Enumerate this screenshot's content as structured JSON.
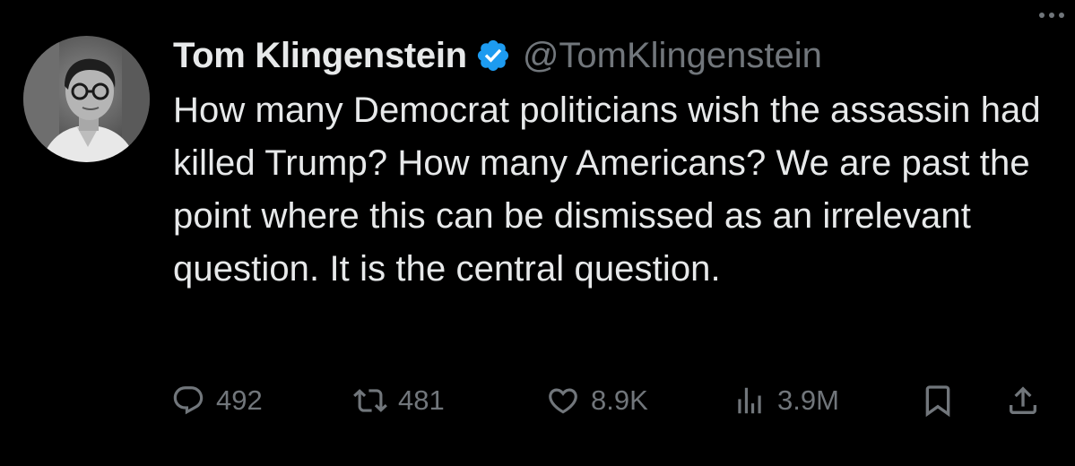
{
  "tweet": {
    "display_name": "Tom Klingenstein",
    "handle": "@TomKlingenstein",
    "verified": true,
    "text": "How many Democrat politicians wish the assassin had killed Trump? How many Americans? We are past the point where this can be dismissed as an irrelevant question. It is the central question."
  },
  "actions": {
    "replies": "492",
    "retweets": "481",
    "likes": "8.9K",
    "views": "3.9M"
  },
  "icons": {
    "more": "more-horizontal-icon",
    "reply": "reply-icon",
    "retweet": "retweet-icon",
    "like": "heart-icon",
    "views": "analytics-icon",
    "bookmark": "bookmark-icon",
    "share": "share-icon",
    "verified": "verified-badge-icon"
  },
  "colors": {
    "background": "#000000",
    "text": "#e7e9ea",
    "secondary": "#71767b",
    "verified": "#1d9bf0"
  }
}
